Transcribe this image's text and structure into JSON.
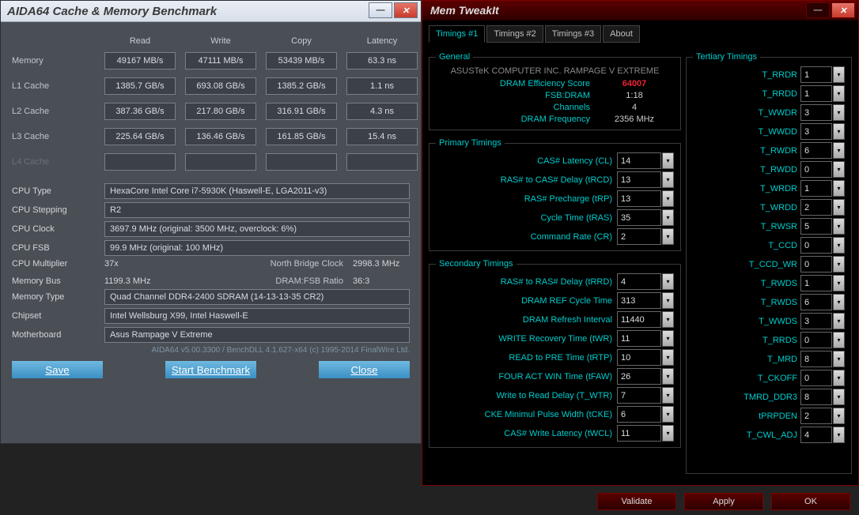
{
  "aida": {
    "title": "AIDA64 Cache & Memory Benchmark",
    "headers": [
      "Read",
      "Write",
      "Copy",
      "Latency"
    ],
    "rows": [
      {
        "label": "Memory",
        "read": "49167 MB/s",
        "write": "47111 MB/s",
        "copy": "53439 MB/s",
        "lat": "63.3 ns"
      },
      {
        "label": "L1 Cache",
        "read": "1385.7 GB/s",
        "write": "693.08 GB/s",
        "copy": "1385.2 GB/s",
        "lat": "1.1 ns"
      },
      {
        "label": "L2 Cache",
        "read": "387.36 GB/s",
        "write": "217.80 GB/s",
        "copy": "316.91 GB/s",
        "lat": "4.3 ns"
      },
      {
        "label": "L3 Cache",
        "read": "225.64 GB/s",
        "write": "136.46 GB/s",
        "copy": "161.85 GB/s",
        "lat": "15.4 ns"
      }
    ],
    "l4label": "L4 Cache",
    "info": {
      "cpu_type_l": "CPU Type",
      "cpu_type": "HexaCore Intel Core i7-5930K (Haswell-E, LGA2011-v3)",
      "cpu_step_l": "CPU Stepping",
      "cpu_step": "R2",
      "cpu_clk_l": "CPU Clock",
      "cpu_clk": "3697.9 MHz  (original: 3500 MHz, overclock: 6%)",
      "cpu_fsb_l": "CPU FSB",
      "cpu_fsb": "99.9 MHz  (original: 100 MHz)",
      "cpu_mul_l": "CPU Multiplier",
      "cpu_mul": "37x",
      "nbc_l": "North Bridge Clock",
      "nbc": "2998.3 MHz",
      "mbus_l": "Memory Bus",
      "mbus": "1199.3 MHz",
      "ratio_l": "DRAM:FSB Ratio",
      "ratio": "36:3",
      "mtype_l": "Memory Type",
      "mtype": "Quad Channel DDR4-2400 SDRAM  (14-13-13-35 CR2)",
      "chip_l": "Chipset",
      "chip": "Intel Wellsburg X99, Intel Haswell-E",
      "mobo_l": "Motherboard",
      "mobo": "Asus Rampage V Extreme"
    },
    "footer": "AIDA64 v5.00.3300 / BenchDLL 4.1.627-x64  (c) 1995-2014 FinalWire Ltd.",
    "buttons": {
      "save": "Save",
      "start": "Start Benchmark",
      "close": "Close"
    }
  },
  "mt": {
    "title": "Mem TweakIt",
    "tabs": [
      "Timings #1",
      "Timings #2",
      "Timings #3",
      "About"
    ],
    "general": {
      "legend": "General",
      "board": "ASUSTeK COMPUTER INC. RAMPAGE V EXTREME",
      "eff_l": "DRAM Efficiency Score",
      "eff": "64007",
      "fsb_l": "FSB:DRAM",
      "fsb": "1:18",
      "ch_l": "Channels",
      "ch": "4",
      "freq_l": "DRAM Frequency",
      "freq": "2356 MHz"
    },
    "primary": {
      "legend": "Primary Timings",
      "items": [
        {
          "l": "CAS# Latency (CL)",
          "v": "14"
        },
        {
          "l": "RAS# to CAS# Delay (tRCD)",
          "v": "13"
        },
        {
          "l": "RAS# Precharge (tRP)",
          "v": "13"
        },
        {
          "l": "Cycle Time (tRAS)",
          "v": "35"
        },
        {
          "l": "Command Rate (CR)",
          "v": "2"
        }
      ]
    },
    "secondary": {
      "legend": "Secondary Timings",
      "items": [
        {
          "l": "RAS# to RAS# Delay (tRRD)",
          "v": "4"
        },
        {
          "l": "DRAM REF Cycle Time",
          "v": "313"
        },
        {
          "l": "DRAM Refresh Interval",
          "v": "11440"
        },
        {
          "l": "WRITE Recovery Time (tWR)",
          "v": "11"
        },
        {
          "l": "READ to PRE Time (tRTP)",
          "v": "10"
        },
        {
          "l": "FOUR ACT WIN Time (tFAW)",
          "v": "26"
        },
        {
          "l": "Write to Read Delay (T_WTR)",
          "v": "7"
        },
        {
          "l": "CKE Minimul Pulse Width (tCKE)",
          "v": "6"
        },
        {
          "l": "CAS# Write Latency (tWCL)",
          "v": "11"
        }
      ]
    },
    "tertiary": {
      "legend": "Tertiary Timings",
      "items": [
        {
          "l": "T_RRDR",
          "v": "1"
        },
        {
          "l": "T_RRDD",
          "v": "1"
        },
        {
          "l": "T_WWDR",
          "v": "3"
        },
        {
          "l": "T_WWDD",
          "v": "3"
        },
        {
          "l": "T_RWDR",
          "v": "6"
        },
        {
          "l": "T_RWDD",
          "v": "0"
        },
        {
          "l": "T_WRDR",
          "v": "1"
        },
        {
          "l": "T_WRDD",
          "v": "2"
        },
        {
          "l": "T_RWSR",
          "v": "5"
        },
        {
          "l": "T_CCD",
          "v": "0"
        },
        {
          "l": "T_CCD_WR",
          "v": "0"
        },
        {
          "l": "T_RWDS",
          "v": "1"
        },
        {
          "l": "T_RWDS",
          "v": "6"
        },
        {
          "l": "T_WWDS",
          "v": "3"
        },
        {
          "l": "T_RRDS",
          "v": "0"
        },
        {
          "l": "T_MRD",
          "v": "8"
        },
        {
          "l": "T_CKOFF",
          "v": "0"
        },
        {
          "l": "TMRD_DDR3",
          "v": "8"
        },
        {
          "l": "tPRPDEN",
          "v": "2"
        },
        {
          "l": "T_CWL_ADJ",
          "v": "4"
        }
      ]
    },
    "buttons": {
      "validate": "Validate",
      "apply": "Apply",
      "ok": "OK"
    }
  }
}
